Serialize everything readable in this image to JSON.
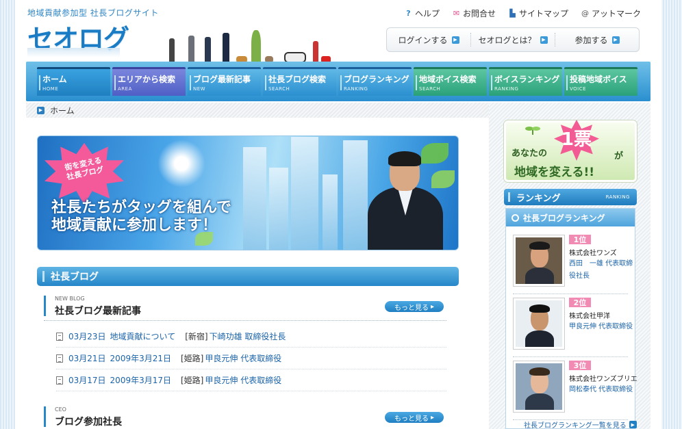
{
  "header": {
    "tagline": "地域貢献参加型 社長ブログサイト",
    "logo": "セオログ",
    "top_links": [
      {
        "label": "ヘルプ",
        "icon": "question-icon",
        "color": "#2f86c6"
      },
      {
        "label": "お問合せ",
        "icon": "mail-icon",
        "color": "#e24d8c"
      },
      {
        "label": "サイトマップ",
        "icon": "sitemap-icon",
        "color": "#2f6fb5"
      },
      {
        "label": "アットマーク",
        "icon": "at-mark-icon",
        "color": "#555555"
      }
    ],
    "sub_nav": [
      "ログインする",
      "セオログとは？",
      "参加する"
    ]
  },
  "nav": {
    "tabs": [
      {
        "label": "ホーム",
        "sub": "HOME",
        "style": "active"
      },
      {
        "label": "エリアから検索",
        "sub": "AREA",
        "style": "area"
      },
      {
        "label": "ブログ最新記事",
        "sub": "NEW",
        "style": ""
      },
      {
        "label": "社長ブログ検索",
        "sub": "SEARCH",
        "style": ""
      },
      {
        "label": "ブログランキング",
        "sub": "RANKING",
        "style": ""
      },
      {
        "label": "地域ボイス検索",
        "sub": "SEARCH",
        "style": "green"
      },
      {
        "label": "ボイスランキング",
        "sub": "RANKING",
        "style": "green"
      },
      {
        "label": "投稿地域ボイス",
        "sub": "VOICE",
        "style": "green"
      }
    ]
  },
  "breadcrumb": {
    "home": "ホーム"
  },
  "hero": {
    "burst_line1": "街を変える",
    "burst_line2": "社長ブログ",
    "copy_line1": "社長たちがタッグを組んで",
    "copy_line2": "地域貢献に参加します！"
  },
  "main": {
    "section_title": "社長ブログ",
    "latest": {
      "small": "NEW BLOG",
      "title": "社長ブログ最新記事",
      "more": "もっと見る",
      "posts": [
        {
          "date": "03月23日",
          "title": "地域貢献について",
          "area": "[新宿]",
          "author": "下崎功雄 取締役社長"
        },
        {
          "date": "03月21日",
          "title": "2009年3月21日",
          "area": "[姫路]",
          "author": "甲良元伸 代表取締役"
        },
        {
          "date": "03月17日",
          "title": "2009年3月17日",
          "area": "[姫路]",
          "author": "甲良元伸 代表取締役"
        }
      ]
    },
    "ceo": {
      "small": "CEO",
      "title": "ブログ参加社長",
      "more": "もっと見る"
    }
  },
  "sidebar": {
    "vote": {
      "line1": "あなたの",
      "one": "1票",
      "ga": "が",
      "line2": "地域を変える!!"
    },
    "ranking_title": "ランキング",
    "ranking_en": "RANKING",
    "ranking_sub": "社長ブログランキング",
    "items": [
      {
        "rank": "1位",
        "company": "株式会社ワンズ",
        "name": "西田　一雄 代表取締役社長"
      },
      {
        "rank": "2位",
        "company": "株式会社甲洋",
        "name": "甲良元伸 代表取締役"
      },
      {
        "rank": "3位",
        "company": "株式会社ワンズブリエ",
        "name": "岡松泰代 代表取締役"
      }
    ],
    "all_link": "社長ブログランキング一覧を見る"
  }
}
